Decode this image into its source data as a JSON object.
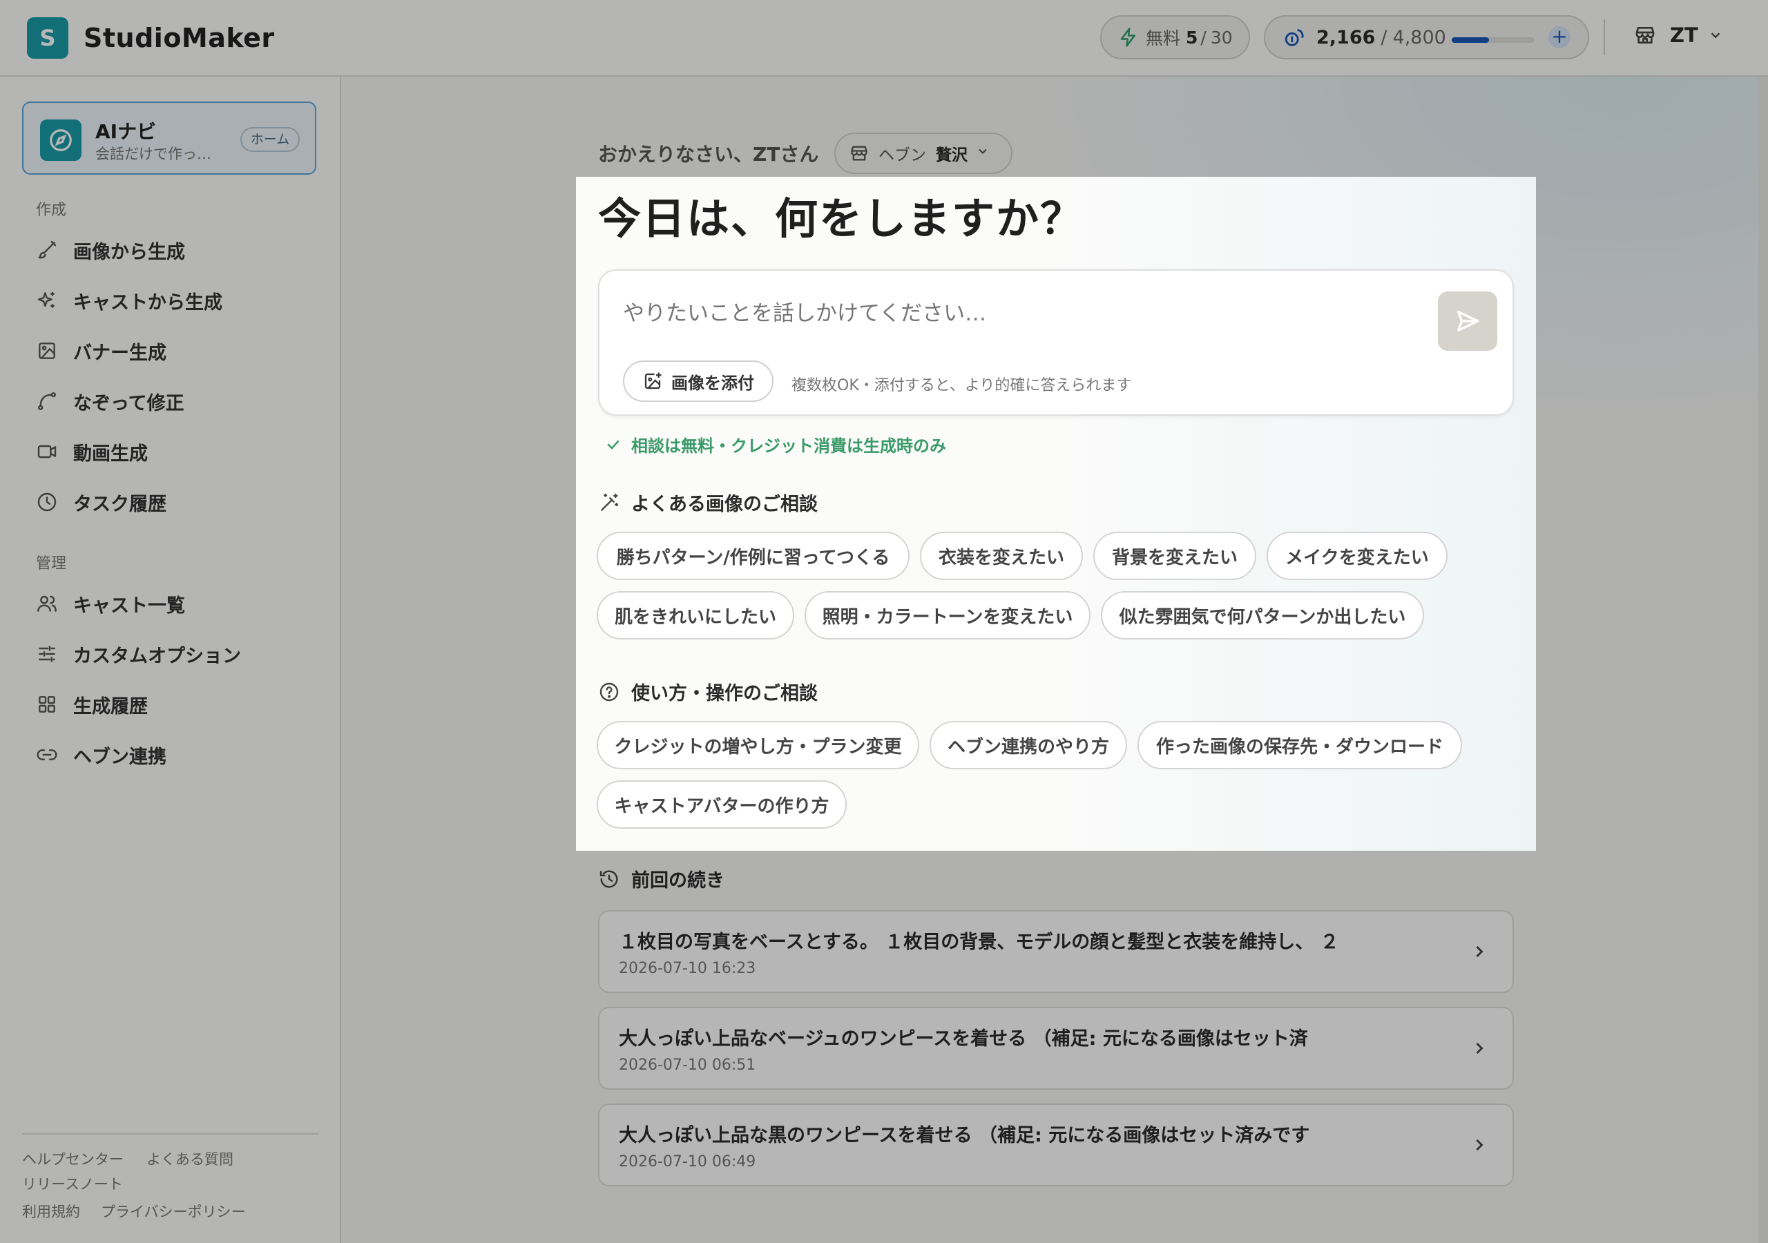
{
  "app": {
    "logo_letter": "S",
    "name": "StudioMaker"
  },
  "header": {
    "free_label": "無料",
    "free_used": "5",
    "free_sep": "/",
    "free_total": "30",
    "credits_value": "2,166",
    "credits_sep": "/",
    "credits_total": "4,800",
    "credits_fill_fraction": 0.45,
    "credits_plus": "+",
    "account_name": "ZT",
    "accent_color": "#1a56b8"
  },
  "sidebar": {
    "ai_card": {
      "title": "AIナビ",
      "subtitle": "会話だけで作っ…",
      "badge": "ホーム"
    },
    "section_create": "作成",
    "create_items": [
      {
        "label": "画像から生成",
        "icon": "brush-icon"
      },
      {
        "label": "キャストから生成",
        "icon": "sparkle-icon"
      },
      {
        "label": "バナー生成",
        "icon": "image-icon"
      },
      {
        "label": "なぞって修正",
        "icon": "curve-icon"
      },
      {
        "label": "動画生成",
        "icon": "video-icon"
      },
      {
        "label": "タスク履歴",
        "icon": "clock-icon"
      }
    ],
    "section_manage": "管理",
    "manage_items": [
      {
        "label": "キャスト一覧",
        "icon": "users-icon"
      },
      {
        "label": "カスタムオプション",
        "icon": "sliders-icon"
      },
      {
        "label": "生成履歴",
        "icon": "grid-icon"
      },
      {
        "label": "ヘブン連携",
        "icon": "link-icon"
      }
    ],
    "footer_links": [
      "ヘルプセンター",
      "よくある質問",
      "リリースノート",
      "利用規約",
      "プライバシーポリシー"
    ]
  },
  "main": {
    "greeting": "おかえりなさい、ZTさん",
    "store": {
      "label": "ヘブン",
      "name": "贅沢"
    },
    "headline": "今日は、何をしますか？",
    "composer": {
      "placeholder": "やりたいことを話しかけてください…",
      "attach_label": "画像を添付",
      "attach_hint": "複数枚OK・添付すると、より的確に答えられます"
    },
    "free_note": "相談は無料・クレジット消費は生成時のみ",
    "image_group": {
      "title": "よくある画像のご相談",
      "chips": [
        "勝ちパターン/作例に習ってつくる",
        "衣装を変えたい",
        "背景を変えたい",
        "メイクを変えたい",
        "肌をきれいにしたい",
        "照明・カラートーンを変えたい",
        "似た雰囲気で何パターンか出したい"
      ]
    },
    "usage_group": {
      "title": "使い方・操作のご相談",
      "chips": [
        "クレジットの増やし方・プラン変更",
        "ヘブン連携のやり方",
        "作った画像の保存先・ダウンロード",
        "キャストアバターの作り方"
      ]
    },
    "previous": {
      "title": "前回の続き",
      "items": [
        {
          "text": "１枚目の写真をベースとする。 １枚目の背景、モデルの顔と髪型と衣装を維持し、 ２",
          "date": "2026-07-10 16:23"
        },
        {
          "text": "大人っぽい上品なベージュのワンピースを着せる （補足: 元になる画像はセット済",
          "date": "2026-07-10 06:51"
        },
        {
          "text": "大人っぽい上品な黒のワンピースを着せる （補足: 元になる画像はセット済みです",
          "date": "2026-07-10 06:49"
        }
      ]
    }
  }
}
